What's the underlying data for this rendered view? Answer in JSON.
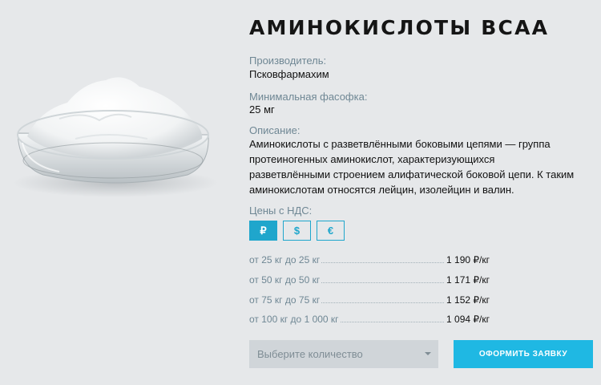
{
  "product": {
    "title": "АМИНОКИСЛОТЫ BCAA",
    "manufacturer_label": "Производитель:",
    "manufacturer": "Псковфармахим",
    "min_pack_label": "Минимальная фасофка:",
    "min_pack": "25 мг",
    "description_label": "Описание:",
    "description": "Аминокислоты с разветвлёнными боковыми цепями — группа протеиногенных аминокислот, характеризующихся разветвлёнными строением алифатической боковой цепи. К таким аминокислотам относятся лейцин, изолейцин и валин."
  },
  "pricing": {
    "label": "Цены с НДС:",
    "currencies": [
      {
        "symbol": "₽",
        "active": true
      },
      {
        "symbol": "$",
        "active": false
      },
      {
        "symbol": "€",
        "active": false
      }
    ],
    "tiers": [
      {
        "range": "от 25 кг до 25 кг",
        "price": "1 190 ₽/кг"
      },
      {
        "range": "от 50 кг до 50 кг",
        "price": "1 171 ₽/кг"
      },
      {
        "range": "от 75 кг до 75 кг",
        "price": "1 152 ₽/кг"
      },
      {
        "range": "от 100 кг до 1 000 кг",
        "price": "1 094 ₽/кг"
      }
    ]
  },
  "order": {
    "quantity_placeholder": "Выберите количество",
    "submit_label": "ОФОРМИТЬ ЗАЯВКУ"
  },
  "colors": {
    "accent": "#1fa6cc",
    "button": "#1fb8e3",
    "label": "#6f8794",
    "background": "#e6e8ea"
  }
}
